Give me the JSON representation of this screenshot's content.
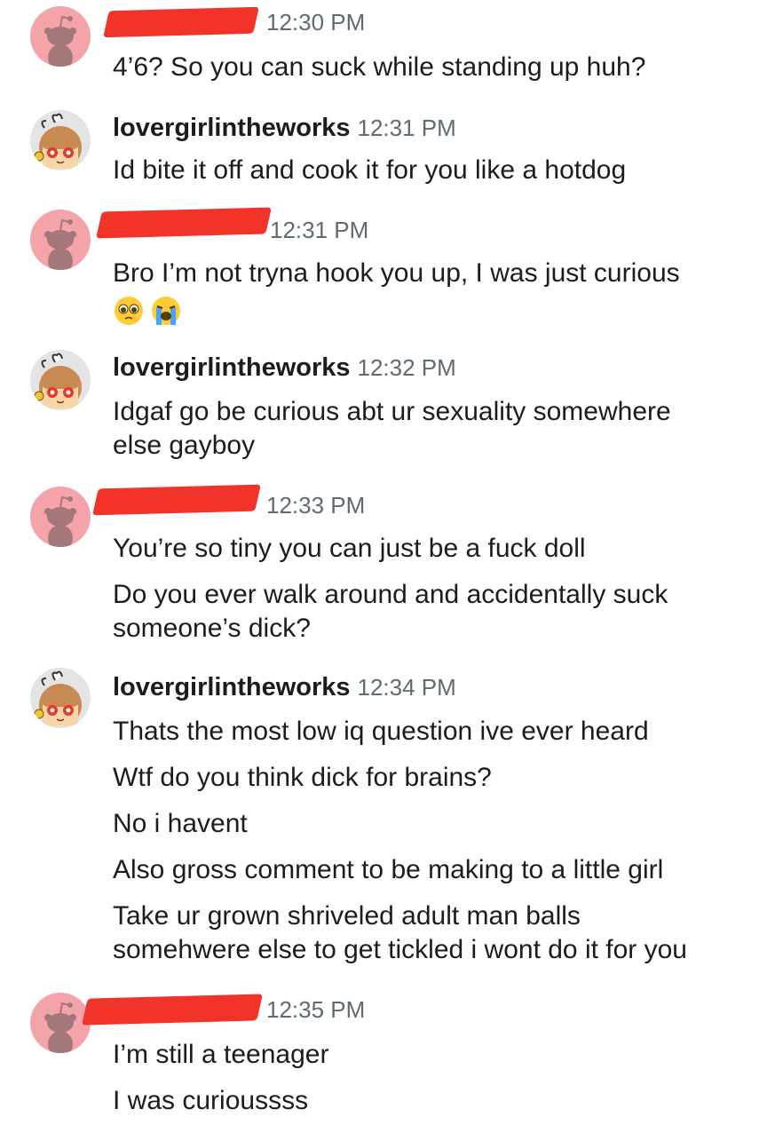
{
  "colors": {
    "redact": "#f2332a",
    "snoo_bg": "#f4a3a9",
    "snoo_body": "#a4777b",
    "timestamp": "#5f6a72",
    "text": "#1c1c1c"
  },
  "messages": [
    {
      "sender": "redacted",
      "time": "12:30 PM",
      "lines": [
        "4’6? So you can suck while standing up huh?"
      ]
    },
    {
      "sender": "lovergirlintheworks",
      "time": "12:31 PM",
      "lines": [
        "Id bite it off and cook it for you like a hotdog"
      ]
    },
    {
      "sender": "redacted",
      "time": "12:31 PM",
      "lines": [
        "Bro I’m not tryna hook you up, I was just curious"
      ],
      "emojis": [
        "pleading-face-emoji",
        "loudly-crying-face-emoji"
      ]
    },
    {
      "sender": "lovergirlintheworks",
      "time": "12:32 PM",
      "lines": [
        "Idgaf go be curious abt ur sexuality somewhere",
        "else gayboy"
      ]
    },
    {
      "sender": "redacted",
      "time": "12:33 PM",
      "lines": [
        "You’re so tiny you can just be a fuck doll",
        "Do you ever walk around and accidentally suck",
        "someone’s dick?"
      ]
    },
    {
      "sender": "lovergirlintheworks",
      "time": "12:34 PM",
      "lines": [
        "Thats the most low iq question ive ever heard",
        "Wtf do you think dick for brains?",
        "No i havent",
        "Also gross comment to be making to a little girl",
        "Take ur grown shriveled adult man balls",
        "somehwere else to get tickled i wont do it for you"
      ]
    },
    {
      "sender": "redacted",
      "time": "12:35 PM",
      "lines": [
        "I’m still a teenager",
        "I was curioussss"
      ]
    }
  ]
}
